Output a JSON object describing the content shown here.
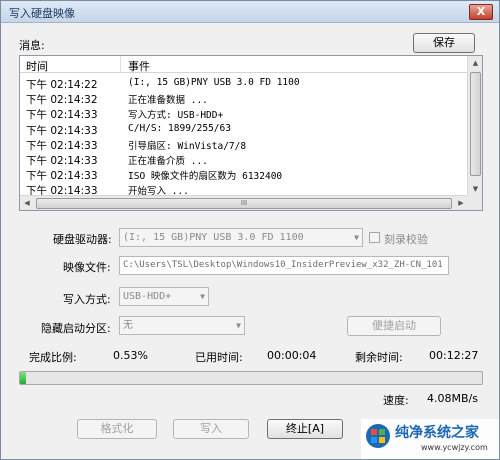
{
  "window": {
    "title": "写入硬盘映像",
    "close_label": "X"
  },
  "messages": {
    "label": "消息:",
    "save_label": "保存",
    "col_time": "时间",
    "col_event": "事件",
    "rows": [
      {
        "time": "下午 02:14:22",
        "event": "(I:, 15 GB)PNY     USB 3.0 FD       1100"
      },
      {
        "time": "下午 02:14:32",
        "event": "正在准备数据 ..."
      },
      {
        "time": "下午 02:14:33",
        "event": "写入方式: USB-HDD+"
      },
      {
        "time": "下午 02:14:33",
        "event": "C/H/S: 1899/255/63"
      },
      {
        "time": "下午 02:14:33",
        "event": "引导扇区: WinVista/7/8"
      },
      {
        "time": "下午 02:14:33",
        "event": "正在准备介质 ..."
      },
      {
        "time": "下午 02:14:33",
        "event": "ISO 映像文件的扇区数为 6132400"
      },
      {
        "time": "下午 02:14:33",
        "event": "开始写入 ..."
      }
    ],
    "scroll_grip": "III"
  },
  "form": {
    "drive_label": "硬盘驱动器:",
    "drive_value": "(I:, 15 GB)PNY     USB 3.0 FD       1100",
    "verify_label": "刻录校验",
    "image_label": "映像文件:",
    "image_value": "C:\\Users\\TSL\\Desktop\\Windows10_InsiderPreview_x32_ZH-CN_101",
    "method_label": "写入方式:",
    "method_value": "USB-HDD+",
    "hidden_label": "隐藏启动分区:",
    "hidden_value": "无",
    "quick_boot_label": "便捷启动"
  },
  "status": {
    "ratio_label": "完成比例:",
    "ratio_value": "0.53%",
    "elapsed_label": "已用时间:",
    "elapsed_value": "00:00:04",
    "remaining_label": "剩余时间:",
    "remaining_value": "00:12:27",
    "progress_fraction": 0.0053,
    "speed_label": "速度:",
    "speed_value": "4.08MB/s"
  },
  "buttons": {
    "format": "格式化",
    "write": "写入",
    "abort": "终止[A]"
  },
  "watermark": {
    "title": "纯净系统之家",
    "url": "www.ycwjzy.com"
  },
  "colors": {
    "progress": "#1fae2f",
    "title_bg": "#c5d6ea",
    "watermark_blue": "#1d67b3"
  }
}
